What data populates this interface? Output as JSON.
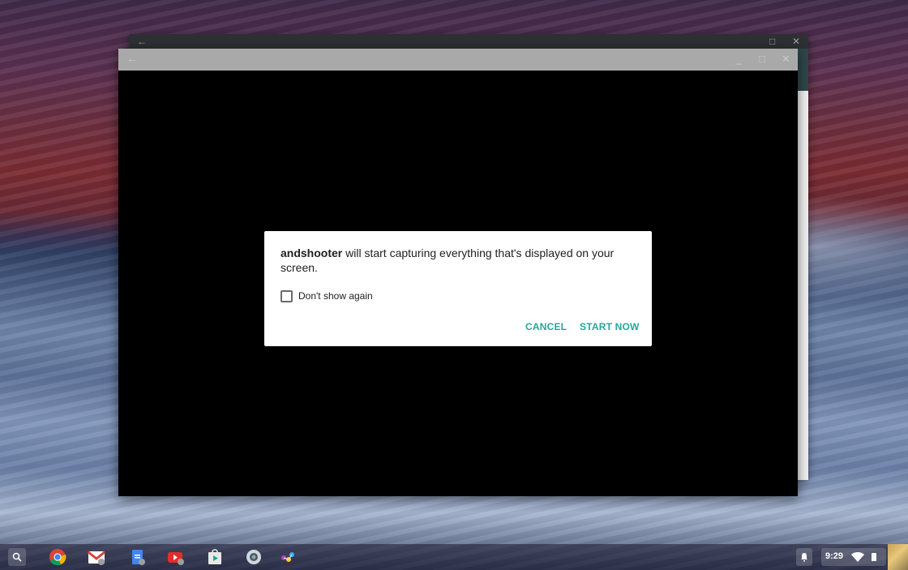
{
  "dialog": {
    "app_name": "andshooter",
    "message_rest": " will start capturing everything that's displayed on your screen.",
    "checkbox_label": "Don't show again",
    "checkbox_checked": false,
    "cancel_label": "CANCEL",
    "start_label": "START NOW",
    "accent_color": "#26a69a"
  },
  "window_controls": {
    "back": "←",
    "minimize": "_",
    "maximize": "□",
    "close": "✕"
  },
  "shelf": {
    "apps": [
      "search-launcher",
      "chrome",
      "gmail",
      "docs",
      "youtube",
      "play-store",
      "camera",
      "photos"
    ],
    "clock": "9:29"
  }
}
